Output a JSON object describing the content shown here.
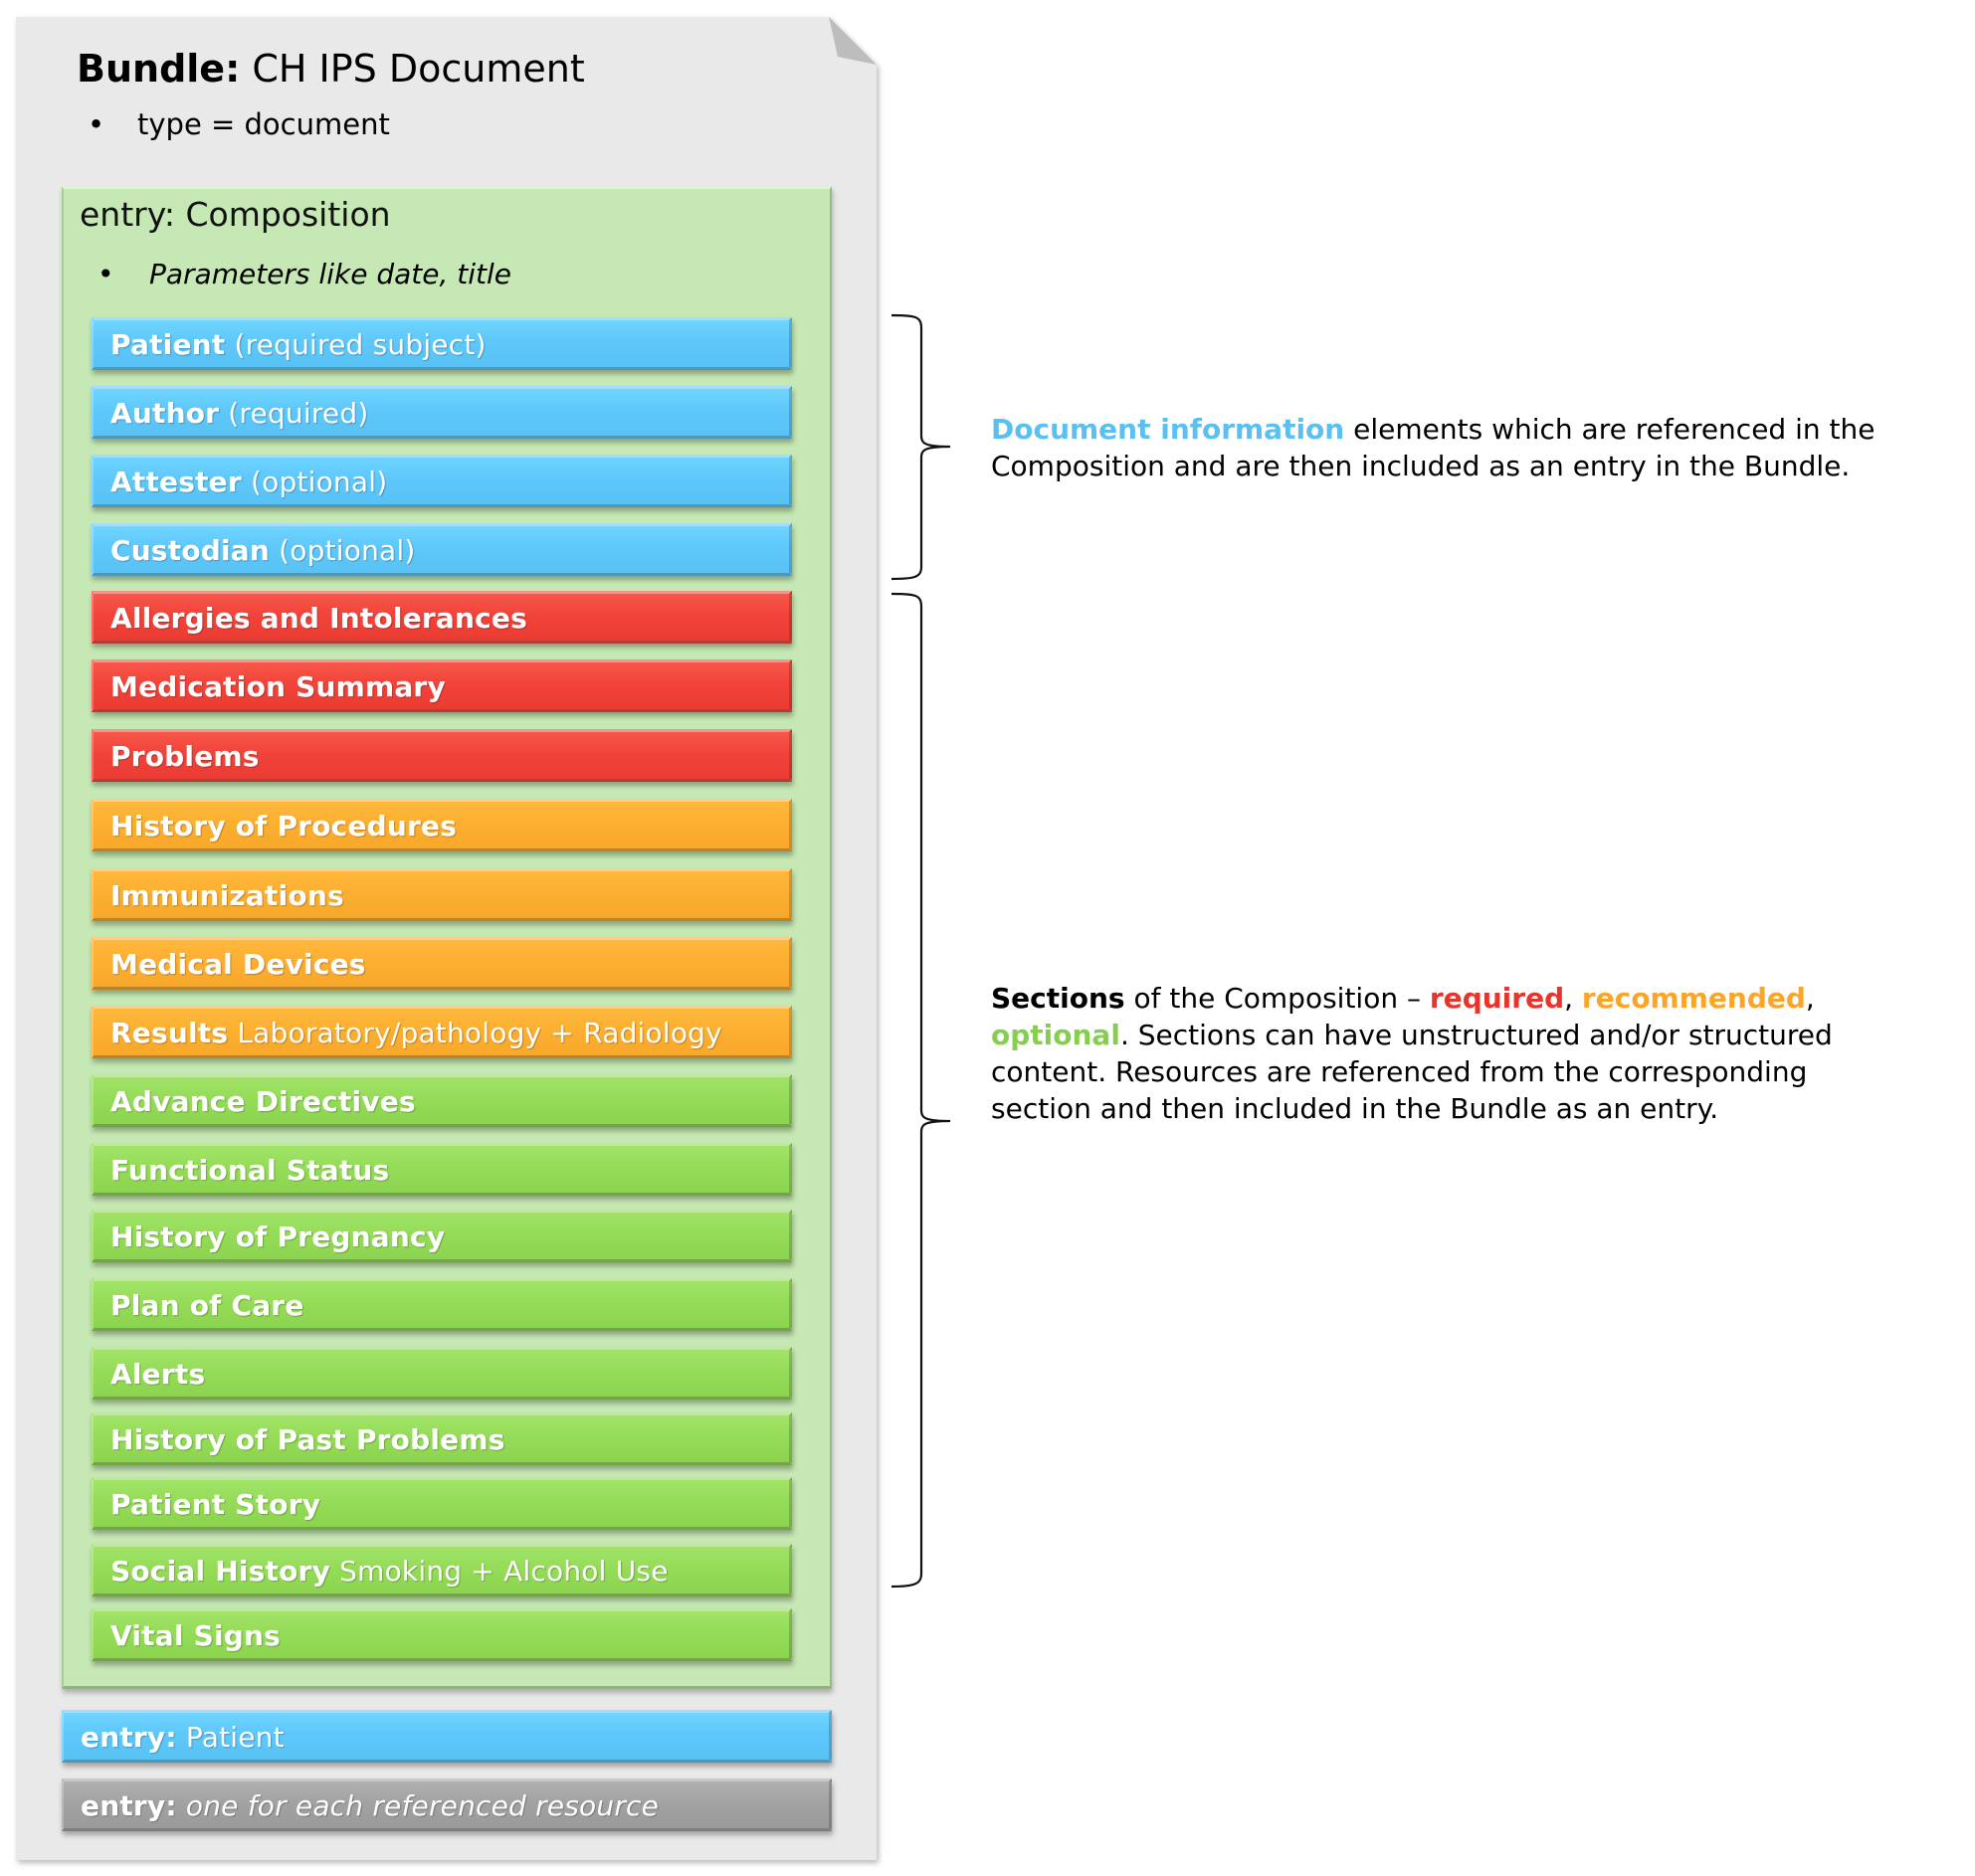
{
  "bundle": {
    "label": "Bundle:",
    "name": "CH IPS Document",
    "bullet": "•",
    "type_line": "type = document"
  },
  "composition": {
    "label": "entry: Composition",
    "bullet": "•",
    "params_line": "Parameters like date, title",
    "document_info": [
      {
        "bold": "Patient",
        "light": "(required subject)",
        "color": "blue"
      },
      {
        "bold": "Author",
        "light": "(required)",
        "color": "blue"
      },
      {
        "bold": "Attester",
        "light": "(optional)",
        "color": "blue"
      },
      {
        "bold": "Custodian",
        "light": "(optional)",
        "color": "blue"
      }
    ],
    "sections": [
      {
        "bold": "Allergies and Intolerances",
        "light": "",
        "level": "required"
      },
      {
        "bold": "Medication Summary",
        "light": "",
        "level": "required"
      },
      {
        "bold": "Problems",
        "light": "",
        "level": "required"
      },
      {
        "bold": "History of Procedures",
        "light": "",
        "level": "recommended"
      },
      {
        "bold": "Immunizations",
        "light": "",
        "level": "recommended"
      },
      {
        "bold": "Medical Devices",
        "light": "",
        "level": "recommended"
      },
      {
        "bold": "Results",
        "light": "Laboratory/pathology + Radiology",
        "level": "recommended"
      },
      {
        "bold": "Advance Directives",
        "light": "",
        "level": "optional"
      },
      {
        "bold": "Functional Status",
        "light": "",
        "level": "optional"
      },
      {
        "bold": "History of Pregnancy",
        "light": "",
        "level": "optional"
      },
      {
        "bold": "Plan of Care",
        "light": "",
        "level": "optional"
      },
      {
        "bold": "Alerts",
        "light": "",
        "level": "optional"
      },
      {
        "bold": "History of Past Problems",
        "light": "",
        "level": "optional"
      },
      {
        "bold": "Patient Story",
        "light": "",
        "level": "optional"
      },
      {
        "bold": "Social History",
        "light": "Smoking + Alcohol Use",
        "level": "optional"
      },
      {
        "bold": "Vital Signs",
        "light": "",
        "level": "optional"
      }
    ]
  },
  "entries": [
    {
      "bold": "entry:",
      "light": "Patient",
      "italic": false,
      "color": "blue"
    },
    {
      "bold": "entry:",
      "light": "one for each referenced resource",
      "italic": true,
      "color": "gray"
    }
  ],
  "annotations": {
    "document_info": {
      "highlight": "Document information",
      "line1_rest": " elements which are referenced in the",
      "line2": "Composition and are then included as an entry in the Bundle."
    },
    "sections": {
      "bold": "Sections",
      "line1_mid": " of the Composition – ",
      "required": "required",
      "comma1": ", ",
      "recommended": "recommended",
      "comma2": ",",
      "optional": "optional",
      "line2_rest": ". Sections can have unstructured and/or structured",
      "line3": "content. Resources are referenced from the corresponding",
      "line4": "section and then included in the Bundle as an entry."
    }
  },
  "colors": {
    "document_info": "#5ec8fb",
    "required": "#f2433a",
    "recommended": "#fdaf31",
    "optional": "#95dc58",
    "entry_other": "#a2a2a2",
    "composition_bg": "#c6e8b4",
    "bundle_bg": "#e9e9e9",
    "text_doc_info": "#5bc0f0",
    "text_required": "#e8352c",
    "text_recommended": "#f9a52a",
    "text_optional": "#86cf4e"
  }
}
